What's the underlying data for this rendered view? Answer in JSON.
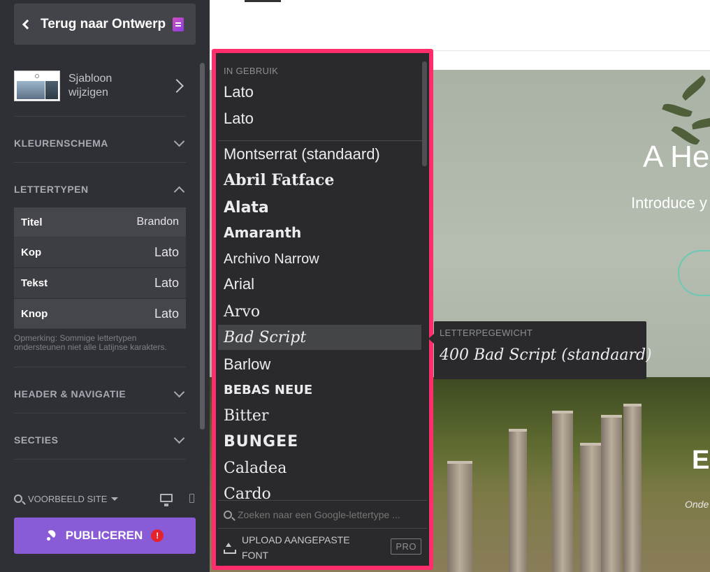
{
  "sidebar": {
    "back_label": "Terug naar Ontwerp",
    "template_label": "Sjabloon wijzigen",
    "sections": {
      "color_scheme": "KLEURENSCHEMA",
      "fonts": "LETTERTYPEN",
      "header_nav": "HEADER & NAVIGATIE",
      "sections": "SECTIES"
    },
    "font_rows": [
      {
        "label": "Titel",
        "value": "Brandon"
      },
      {
        "label": "Kop",
        "value": "Lato"
      },
      {
        "label": "Tekst",
        "value": "Lato"
      },
      {
        "label": "Knop",
        "value": "Lato"
      }
    ],
    "note": "Opmerking: Sommige lettertypen ondersteunen niet alle Latijnse karakters.",
    "preview_label": "VOORBEELD SITE",
    "publish_label": "PUBLICEREN",
    "publish_alert": "!",
    "accent_color": "#8a5bd6"
  },
  "dropdown": {
    "in_use_label": "IN GEBRUIK",
    "in_use": [
      "Lato",
      "Lato"
    ],
    "fonts": [
      "Montserrat (standaard)",
      "Abril Fatface",
      "Alata",
      "Amaranth",
      "Archivo Narrow",
      "Arial",
      "Arvo",
      "Bad Script",
      "Barlow",
      "BEBAS NEUE",
      "Bitter",
      "BUNGEE",
      "Caladea",
      "Cardo"
    ],
    "selected_index": 7,
    "search_placeholder": "Zoeken naar een Google-lettertype ...",
    "upload_label": "UPLOAD AANGEPASTE FONT",
    "pro_badge": "PRO",
    "highlight_color": "#ff2d6b"
  },
  "weight_popup": {
    "label": "LETTERPEGEWICHT",
    "value": "400 Bad Script (standaard)"
  },
  "preview": {
    "hero_title": "A He",
    "hero_sub": "Introduce y",
    "lake_title": "E",
    "lake_sub": "Onde"
  }
}
